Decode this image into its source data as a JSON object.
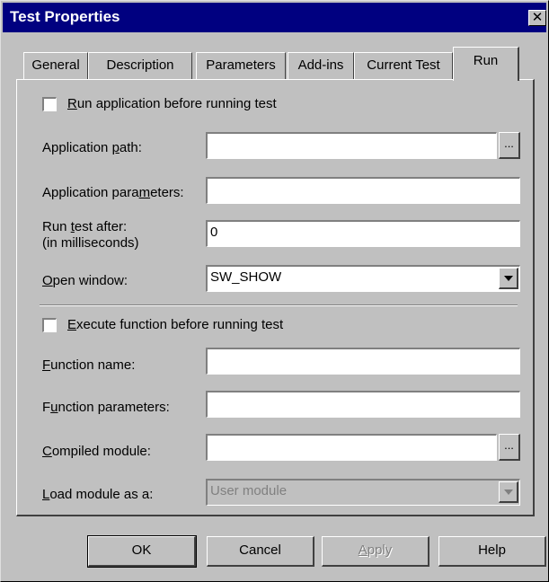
{
  "window": {
    "title": "Test Properties",
    "close_glyph": "✕"
  },
  "tabs": [
    {
      "label": "General"
    },
    {
      "label": "Description"
    },
    {
      "label": "Parameters"
    },
    {
      "label": "Add-ins"
    },
    {
      "label": "Current Test"
    },
    {
      "label": "Run"
    }
  ],
  "active_tab": "Run",
  "run_section": {
    "run_app_checkbox": {
      "label_u": "R",
      "label_rest": "un application before running test",
      "checked": false
    },
    "app_path": {
      "label_pre": "Application ",
      "label_u": "p",
      "label_post": "ath:",
      "value": "",
      "browse": "..."
    },
    "app_params": {
      "label_pre": "Application para",
      "label_u": "m",
      "label_post": "eters:",
      "value": ""
    },
    "run_after": {
      "label_line1_pre": "Run ",
      "label_line1_u": "t",
      "label_line1_post": "est after:",
      "label_line2": "(in milliseconds)",
      "value": "0"
    },
    "open_window": {
      "label_u": "O",
      "label_rest": "pen window:",
      "value": "SW_SHOW"
    }
  },
  "function_section": {
    "exec_fn_checkbox": {
      "label_u": "E",
      "label_rest": "xecute function before running test",
      "checked": false
    },
    "fn_name": {
      "label_u": "F",
      "label_rest": "unction name:",
      "value": ""
    },
    "fn_params": {
      "label_pre": "F",
      "label_u": "u",
      "label_post": "nction parameters:",
      "value": ""
    },
    "compiled_module": {
      "label_u": "C",
      "label_rest": "ompiled module:",
      "value": "",
      "browse": "..."
    },
    "load_module": {
      "label_u": "L",
      "label_rest": "oad module as a:",
      "value": "User module",
      "disabled": true
    }
  },
  "buttons": {
    "ok": "OK",
    "cancel": "Cancel",
    "apply_u": "A",
    "apply_rest": "pply",
    "help": "Help"
  }
}
